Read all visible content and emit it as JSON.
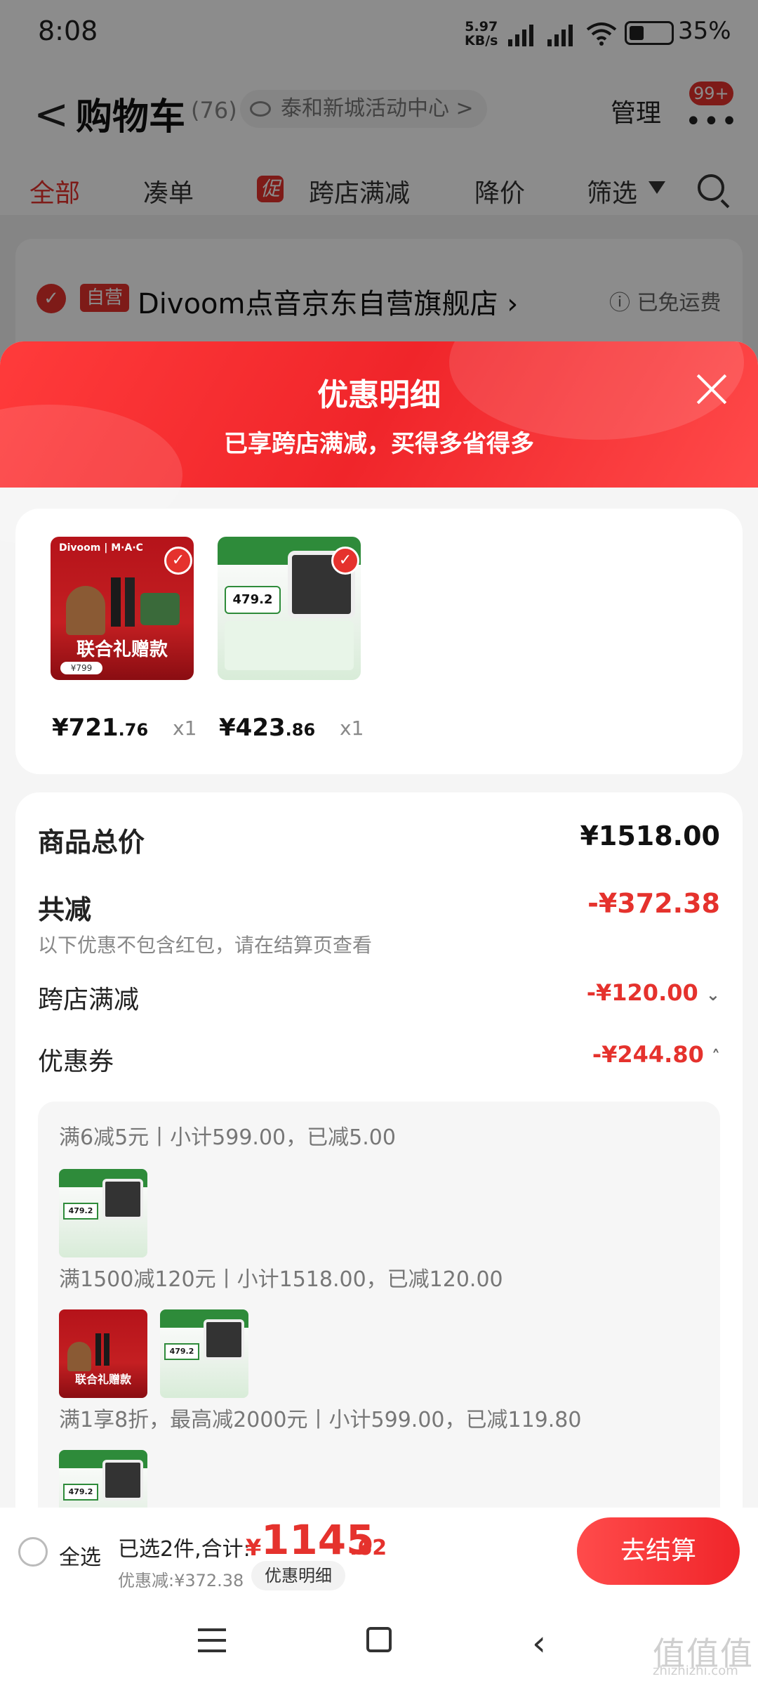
{
  "status_bar": {
    "time": "8:08",
    "net_speed_value": "5.97",
    "net_speed_unit": "KB/s",
    "battery": "35%"
  },
  "header": {
    "back_glyph": "<",
    "title": "购物车",
    "count": "(76)",
    "location": "泰和新城活动中心",
    "location_chevron": ">",
    "manage": "管理",
    "badge": "99+"
  },
  "tabs": [
    {
      "label": "全部"
    },
    {
      "label": "凑单"
    },
    {
      "label": "跨店满减"
    },
    {
      "label": "降价"
    },
    {
      "label": "筛选"
    }
  ],
  "promo_badge": "促",
  "store": {
    "tag": "自营",
    "name": "Divoom点音京东自营旗舰店",
    "shipping": "已免运费"
  },
  "sheet": {
    "title": "优惠明细",
    "subtitle": "已享跨店满减，买得多省得多"
  },
  "products": [
    {
      "price_int": "¥721",
      "price_dec": ".76",
      "qty": "x1",
      "banner": "联合礼赠款",
      "tag_price": "¥799"
    },
    {
      "price_int": "¥423",
      "price_dec": ".86",
      "qty": "x1",
      "tag_price": "479.2"
    }
  ],
  "summary": {
    "total_label": "商品总价",
    "total_value": "¥1518.00",
    "reduce_label": "共减",
    "reduce_value": "-¥372.38",
    "reduce_note": "以下优惠不包含红包，请在结算页查看",
    "cross_label": "跨店满减",
    "cross_value": "-¥120.00",
    "coupon_label": "优惠券",
    "coupon_value": "-¥244.80"
  },
  "coupons": [
    {
      "text": "满6减5元丨小计599.00，已减5.00"
    },
    {
      "text": "满1500减120元丨小计1518.00，已减120.00"
    },
    {
      "text": "满1享8折，最高减2000元丨小计599.00，已减119.80"
    }
  ],
  "bottom": {
    "select_all": "全选",
    "selected_text": "已选2件,合计:",
    "currency": "¥",
    "total_int": "1145",
    "total_dec": ".62",
    "discount_text": "优惠减:¥372.38",
    "detail_label": "优惠明细",
    "checkout": "去结算"
  },
  "watermark": {
    "main": "值值值",
    "sub": "zhizhizhi.com"
  },
  "colors": {
    "accent": "#e5322d",
    "sheet_header": "#f0252a"
  },
  "icons": [
    "eye-icon",
    "more-dots-icon",
    "funnel-icon",
    "search-icon",
    "check-icon",
    "info-icon",
    "close-icon",
    "chevron-down-icon",
    "chevron-up-icon",
    "menu-icon",
    "home-icon",
    "back-icon"
  ]
}
